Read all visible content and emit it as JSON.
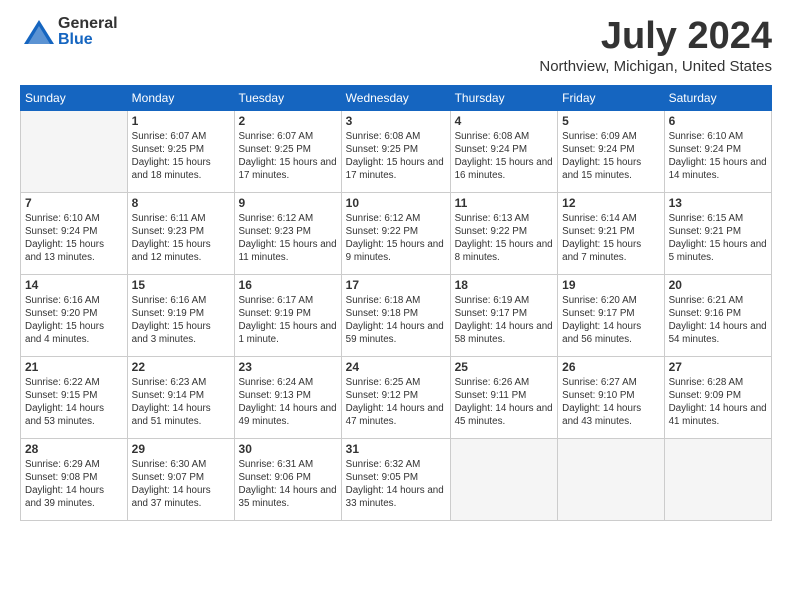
{
  "logo": {
    "general": "General",
    "blue": "Blue"
  },
  "title": "July 2024",
  "subtitle": "Northview, Michigan, United States",
  "days_of_week": [
    "Sunday",
    "Monday",
    "Tuesday",
    "Wednesday",
    "Thursday",
    "Friday",
    "Saturday"
  ],
  "weeks": [
    [
      {
        "day": "",
        "info": ""
      },
      {
        "day": "1",
        "info": "Sunrise: 6:07 AM\nSunset: 9:25 PM\nDaylight: 15 hours\nand 18 minutes."
      },
      {
        "day": "2",
        "info": "Sunrise: 6:07 AM\nSunset: 9:25 PM\nDaylight: 15 hours\nand 17 minutes."
      },
      {
        "day": "3",
        "info": "Sunrise: 6:08 AM\nSunset: 9:25 PM\nDaylight: 15 hours\nand 17 minutes."
      },
      {
        "day": "4",
        "info": "Sunrise: 6:08 AM\nSunset: 9:24 PM\nDaylight: 15 hours\nand 16 minutes."
      },
      {
        "day": "5",
        "info": "Sunrise: 6:09 AM\nSunset: 9:24 PM\nDaylight: 15 hours\nand 15 minutes."
      },
      {
        "day": "6",
        "info": "Sunrise: 6:10 AM\nSunset: 9:24 PM\nDaylight: 15 hours\nand 14 minutes."
      }
    ],
    [
      {
        "day": "7",
        "info": "Sunrise: 6:10 AM\nSunset: 9:24 PM\nDaylight: 15 hours\nand 13 minutes."
      },
      {
        "day": "8",
        "info": "Sunrise: 6:11 AM\nSunset: 9:23 PM\nDaylight: 15 hours\nand 12 minutes."
      },
      {
        "day": "9",
        "info": "Sunrise: 6:12 AM\nSunset: 9:23 PM\nDaylight: 15 hours\nand 11 minutes."
      },
      {
        "day": "10",
        "info": "Sunrise: 6:12 AM\nSunset: 9:22 PM\nDaylight: 15 hours\nand 9 minutes."
      },
      {
        "day": "11",
        "info": "Sunrise: 6:13 AM\nSunset: 9:22 PM\nDaylight: 15 hours\nand 8 minutes."
      },
      {
        "day": "12",
        "info": "Sunrise: 6:14 AM\nSunset: 9:21 PM\nDaylight: 15 hours\nand 7 minutes."
      },
      {
        "day": "13",
        "info": "Sunrise: 6:15 AM\nSunset: 9:21 PM\nDaylight: 15 hours\nand 5 minutes."
      }
    ],
    [
      {
        "day": "14",
        "info": "Sunrise: 6:16 AM\nSunset: 9:20 PM\nDaylight: 15 hours\nand 4 minutes."
      },
      {
        "day": "15",
        "info": "Sunrise: 6:16 AM\nSunset: 9:19 PM\nDaylight: 15 hours\nand 3 minutes."
      },
      {
        "day": "16",
        "info": "Sunrise: 6:17 AM\nSunset: 9:19 PM\nDaylight: 15 hours\nand 1 minute."
      },
      {
        "day": "17",
        "info": "Sunrise: 6:18 AM\nSunset: 9:18 PM\nDaylight: 14 hours\nand 59 minutes."
      },
      {
        "day": "18",
        "info": "Sunrise: 6:19 AM\nSunset: 9:17 PM\nDaylight: 14 hours\nand 58 minutes."
      },
      {
        "day": "19",
        "info": "Sunrise: 6:20 AM\nSunset: 9:17 PM\nDaylight: 14 hours\nand 56 minutes."
      },
      {
        "day": "20",
        "info": "Sunrise: 6:21 AM\nSunset: 9:16 PM\nDaylight: 14 hours\nand 54 minutes."
      }
    ],
    [
      {
        "day": "21",
        "info": "Sunrise: 6:22 AM\nSunset: 9:15 PM\nDaylight: 14 hours\nand 53 minutes."
      },
      {
        "day": "22",
        "info": "Sunrise: 6:23 AM\nSunset: 9:14 PM\nDaylight: 14 hours\nand 51 minutes."
      },
      {
        "day": "23",
        "info": "Sunrise: 6:24 AM\nSunset: 9:13 PM\nDaylight: 14 hours\nand 49 minutes."
      },
      {
        "day": "24",
        "info": "Sunrise: 6:25 AM\nSunset: 9:12 PM\nDaylight: 14 hours\nand 47 minutes."
      },
      {
        "day": "25",
        "info": "Sunrise: 6:26 AM\nSunset: 9:11 PM\nDaylight: 14 hours\nand 45 minutes."
      },
      {
        "day": "26",
        "info": "Sunrise: 6:27 AM\nSunset: 9:10 PM\nDaylight: 14 hours\nand 43 minutes."
      },
      {
        "day": "27",
        "info": "Sunrise: 6:28 AM\nSunset: 9:09 PM\nDaylight: 14 hours\nand 41 minutes."
      }
    ],
    [
      {
        "day": "28",
        "info": "Sunrise: 6:29 AM\nSunset: 9:08 PM\nDaylight: 14 hours\nand 39 minutes."
      },
      {
        "day": "29",
        "info": "Sunrise: 6:30 AM\nSunset: 9:07 PM\nDaylight: 14 hours\nand 37 minutes."
      },
      {
        "day": "30",
        "info": "Sunrise: 6:31 AM\nSunset: 9:06 PM\nDaylight: 14 hours\nand 35 minutes."
      },
      {
        "day": "31",
        "info": "Sunrise: 6:32 AM\nSunset: 9:05 PM\nDaylight: 14 hours\nand 33 minutes."
      },
      {
        "day": "",
        "info": ""
      },
      {
        "day": "",
        "info": ""
      },
      {
        "day": "",
        "info": ""
      }
    ]
  ]
}
